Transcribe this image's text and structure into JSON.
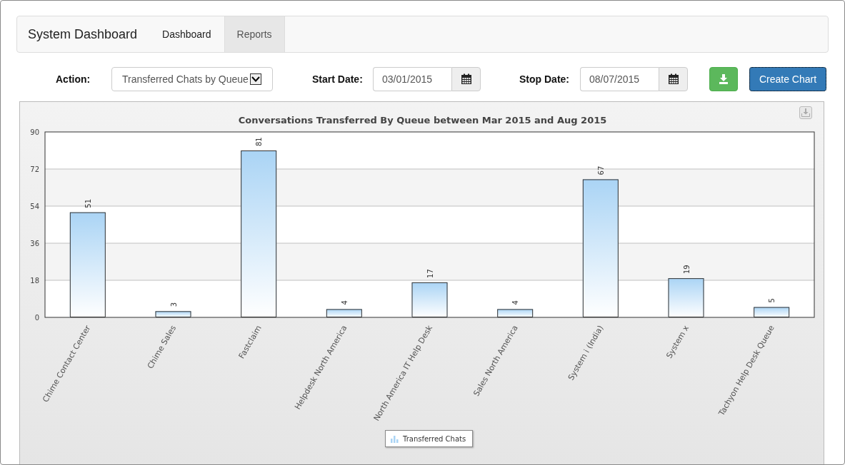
{
  "navbar": {
    "brand": "System Dashboard",
    "tabs": [
      {
        "label": "Dashboard",
        "selected": false
      },
      {
        "label": "Reports",
        "selected": true
      }
    ]
  },
  "controls": {
    "action_label": "Action:",
    "action_value": "Transferred Chats by Queue",
    "start_label": "Start Date:",
    "start_value": "03/01/2015",
    "stop_label": "Stop Date:",
    "stop_value": "08/07/2015",
    "create_button": "Create Chart"
  },
  "chart": {
    "chart_data": {
      "type": "bar",
      "title": "Conversations Transferred By Queue between Mar 2015 and Aug 2015",
      "categories": [
        "Chime Contact Center",
        "Chime Sales",
        "Fastclaim",
        "Helpdesk North America",
        "North America IT Help Desk",
        "Sales North America",
        "System i (India)",
        "System x",
        "Tachyon Help Desk Queue"
      ],
      "series": [
        {
          "name": "Transferred Chats",
          "color": "#aad4f5",
          "values": [
            51,
            3,
            81,
            4,
            17,
            4,
            67,
            19,
            5
          ]
        }
      ],
      "ylim": [
        0,
        90
      ],
      "grid": true,
      "yticks": [
        0,
        18,
        36,
        54,
        72,
        90
      ],
      "data_labels": true
    }
  }
}
